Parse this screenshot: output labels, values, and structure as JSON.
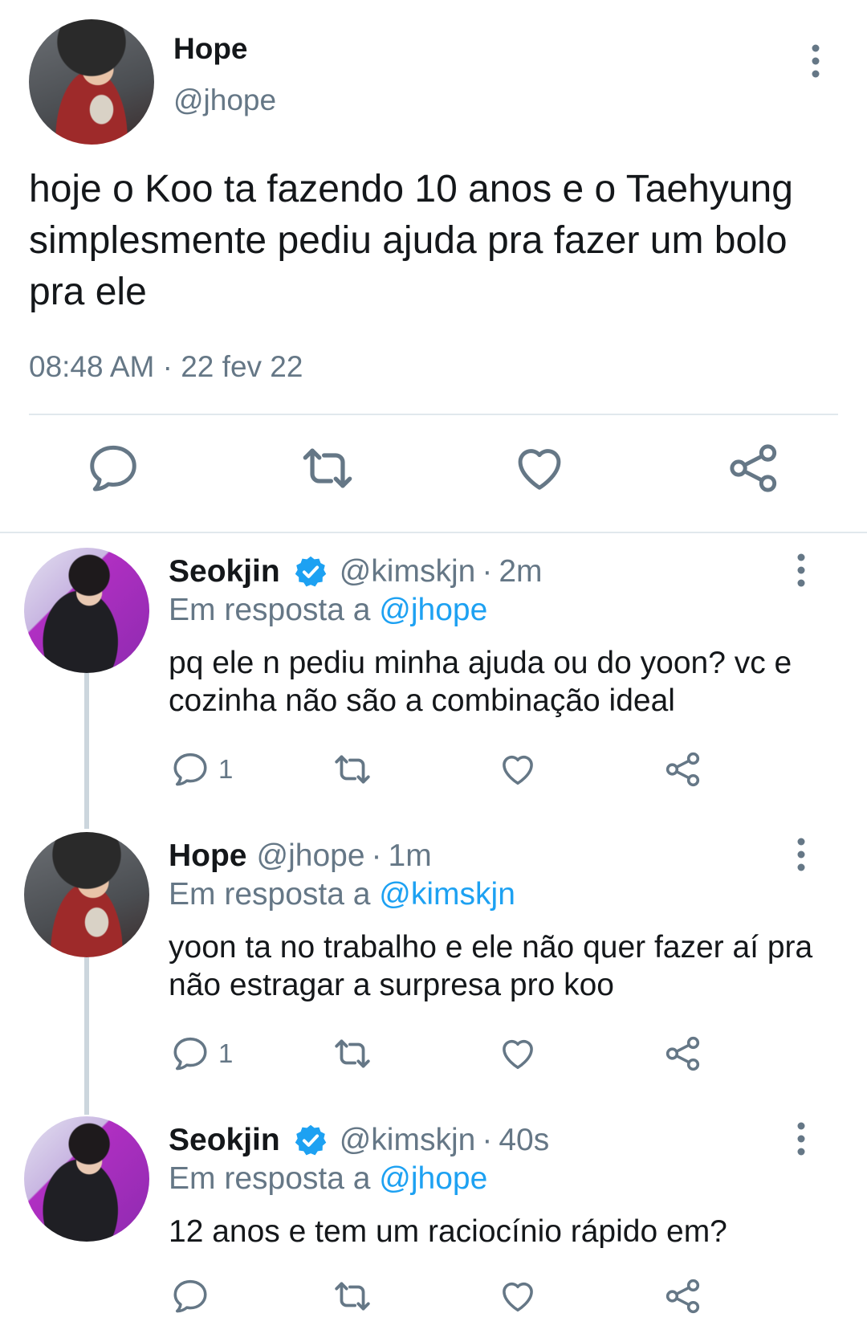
{
  "main_tweet": {
    "name": "Hope",
    "handle": "@jhope",
    "text": "hoje o Koo ta fazendo 10 anos e o Taehyung simplesmente pediu ajuda pra fazer um bolo pra ele",
    "time": "08:48 AM",
    "dot": "·",
    "date": "22 fev 22"
  },
  "replies": [
    {
      "name": "Seokjin",
      "verified": true,
      "handle": "@kimskjn",
      "dot": "·",
      "time": "2m",
      "in_reply_prefix": "Em resposta a",
      "in_reply_to": "@jhope",
      "text": "pq ele n pediu minha ajuda ou do yoon? vc e cozinha não são a combinação ideal",
      "reply_count": "1"
    },
    {
      "name": "Hope",
      "verified": false,
      "handle": "@jhope",
      "dot": "·",
      "time": "1m",
      "in_reply_prefix": "Em resposta a",
      "in_reply_to": "@kimskjn",
      "text": "yoon ta no trabalho e ele não quer fazer aí pra não estragar a surpresa pro koo",
      "reply_count": "1"
    },
    {
      "name": "Seokjin",
      "verified": true,
      "handle": "@kimskjn",
      "dot": "·",
      "time": "40s",
      "in_reply_prefix": "Em resposta a",
      "in_reply_to": "@jhope",
      "text": "12 anos e tem um raciocínio rápido em?",
      "reply_count": ""
    }
  ],
  "icons": {
    "reply": "comment-bubble-icon",
    "retweet": "retweet-icon",
    "like": "heart-icon",
    "share": "share-icon",
    "more": "vertical-dots-icon",
    "verified": "verified-badge-icon"
  },
  "colors": {
    "text": "#14171a",
    "secondary": "#657786",
    "link": "#1da1f2",
    "icon": "#657786",
    "divider": "#e1e8ed",
    "thread_line": "#ccd6dd"
  }
}
